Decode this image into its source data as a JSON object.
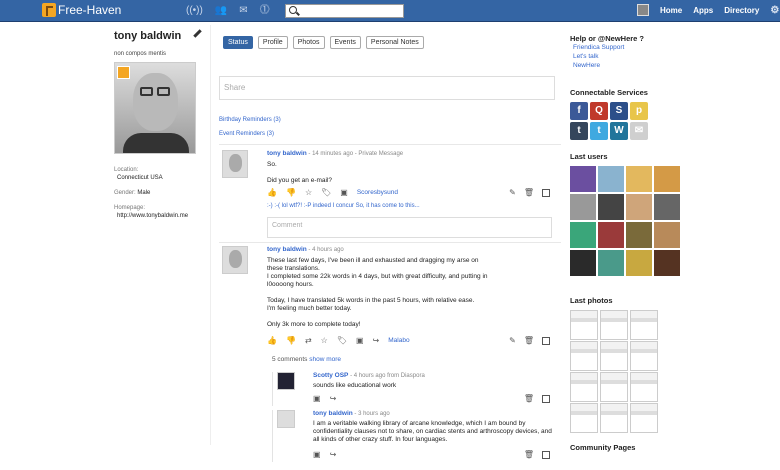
{
  "navbar": {
    "site_name": "Free-Haven",
    "search_placeholder": "",
    "links": [
      "Home",
      "Apps",
      "Directory"
    ]
  },
  "profile": {
    "name": "tony baldwin",
    "nickname": "non compos mentis",
    "location_label": "Location:",
    "location": "Connecticut USA",
    "gender_label": "Gender:",
    "gender": "Male",
    "homepage_label": "Homepage:",
    "homepage": "http://www.tonybaldwin.me"
  },
  "tabs": [
    "Status",
    "Profile",
    "Photos",
    "Events",
    "Personal Notes"
  ],
  "share_placeholder": "Share",
  "reminders": {
    "birthday": "Birthday Reminders (3)",
    "event": "Event Reminders (3)"
  },
  "post1": {
    "author": "tony baldwin",
    "meta": " - 14 minutes ago - Private Message",
    "lines": [
      "So.",
      "",
      "Did you get an e-mail?"
    ],
    "tag": "Scoresbysund",
    "emojis": ":-)   :-(   lol   wtf?!   :-P   indeed   I concur   So, it has come to this...",
    "comment_placeholder": "Comment"
  },
  "post2": {
    "author": "tony baldwin",
    "meta": " - 4 hours ago",
    "lines": [
      "These last few days, I've been ill and exhausted and dragging my arse on",
      "these translations.",
      "I completed some 22k words in 4 days, but with great difficulty, and putting in",
      "l0oooong hours.",
      "",
      "Today, I have translated 5k words in the past 5 hours, with relative ease.",
      "I'm feeling much better today.",
      "",
      "Only 3k more to complete today!"
    ],
    "tag": "Malabo",
    "comments_count": "5 comments",
    "show_more": "show more"
  },
  "comments": [
    {
      "author": "Scotty OSP",
      "meta": " - 4 hours ago from Diaspora",
      "text": "sounds like educational work"
    },
    {
      "author": "tony baldwin",
      "meta": " - 3 hours ago",
      "text": "I am a veritable walking library of arcane knowledge, which I am bound by confidentiality clauses not to share, on cardiac stents and arthroscopy devices, and all kinds of other crazy stuff. In four languages."
    }
  ],
  "sidebar": {
    "help_title": "Help or @NewHere ?",
    "help_links": [
      "Friendica Support",
      "Let's talk",
      "NewHere"
    ],
    "services_title": "Connectable Services",
    "services": [
      {
        "icon": "facebook-icon",
        "glyph": "f",
        "color": "#3b5998"
      },
      {
        "icon": "feed-icon",
        "glyph": "Q",
        "color": "#c0392b"
      },
      {
        "icon": "statusnet-icon",
        "glyph": "S",
        "color": "#2c4f8a"
      },
      {
        "icon": "posterous-icon",
        "glyph": "p",
        "color": "#e8c54a"
      },
      {
        "icon": "tumblr-icon",
        "glyph": "t",
        "color": "#35465c"
      },
      {
        "icon": "twitter-icon",
        "glyph": "t",
        "color": "#3fa9e0"
      },
      {
        "icon": "wordpress-icon",
        "glyph": "W",
        "color": "#21759b"
      },
      {
        "icon": "email-icon",
        "glyph": "✉",
        "color": "#cfcfcf"
      }
    ],
    "last_users_title": "Last users",
    "user_colors": [
      "#6b4fa0",
      "#8ab3cf",
      "#e3b85e",
      "#d49a46",
      "#999999",
      "#444444",
      "#cfa57a",
      "#666666",
      "#3aa67a",
      "#9a3a3a",
      "#7a6a3a",
      "#b88a5a",
      "#2a2a2a",
      "#4a9a8a",
      "#c8a840",
      "#553322"
    ],
    "last_photos_title": "Last photos",
    "community_title": "Community Pages"
  }
}
